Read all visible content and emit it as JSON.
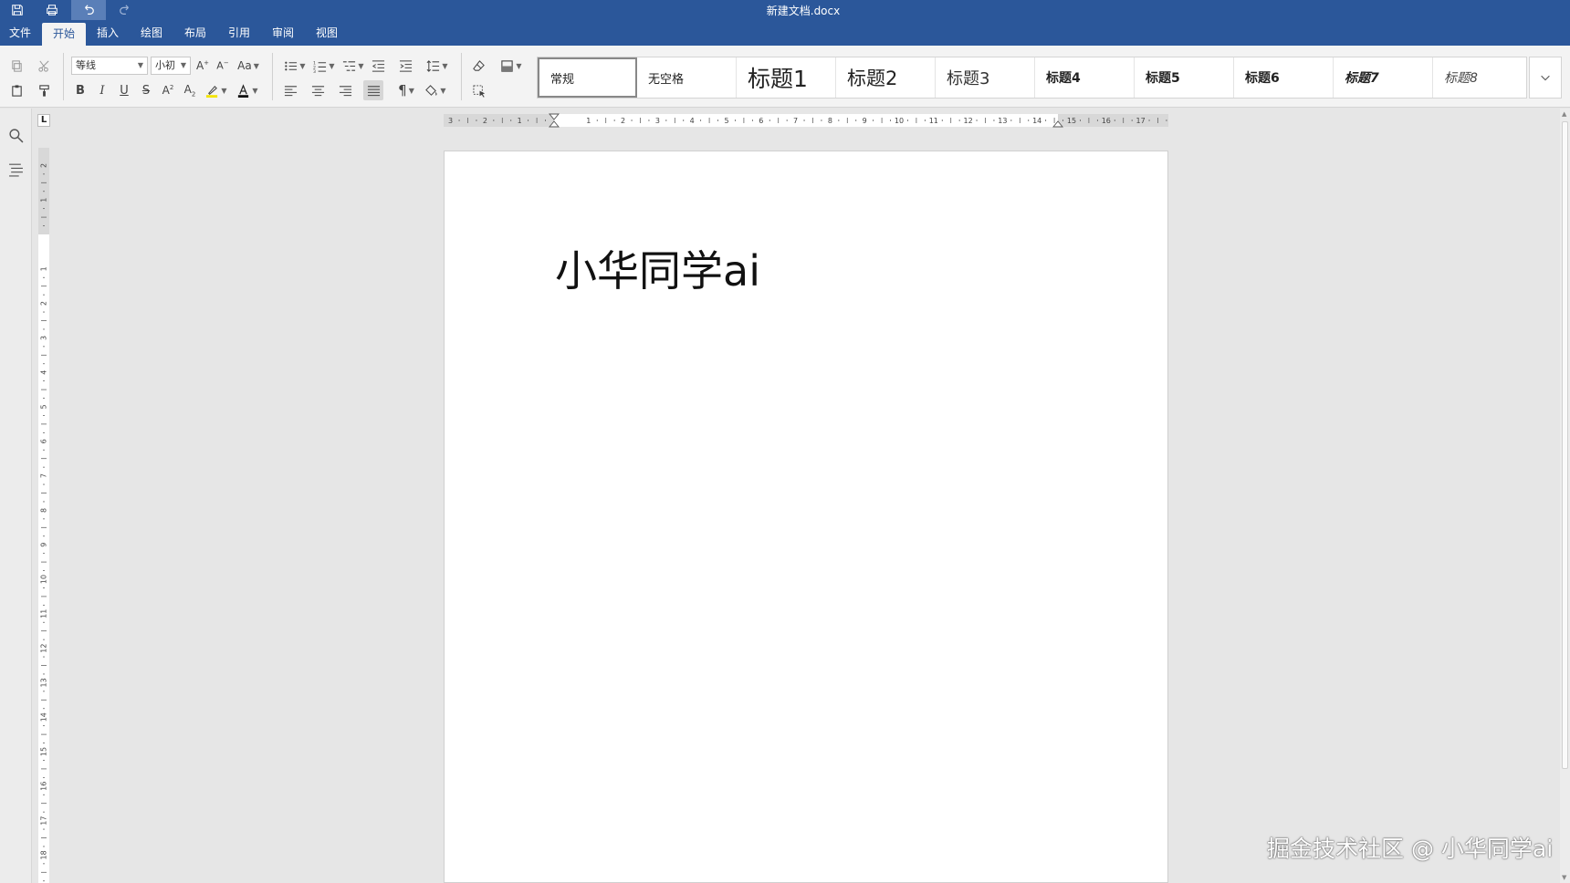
{
  "window": {
    "title": "新建文档.docx"
  },
  "menu": {
    "items": [
      "文件",
      "开始",
      "插入",
      "绘图",
      "布局",
      "引用",
      "审阅",
      "视图"
    ],
    "active": "开始"
  },
  "ribbon": {
    "font_name": "等线",
    "font_size": "小初",
    "styles": [
      "常规",
      "无空格",
      "标题1",
      "标题2",
      "标题3",
      "标题4",
      "标题5",
      "标题6",
      "标题7",
      "标题8"
    ],
    "selected_style": "常规"
  },
  "ruler": {
    "horizontal_labels": [
      "3",
      "2",
      "1",
      "1",
      "2",
      "3",
      "4",
      "5",
      "6",
      "7",
      "8",
      "9",
      "10",
      "11",
      "12",
      "13",
      "14",
      "15",
      "16",
      "17"
    ],
    "vertical_labels": [
      "2",
      "1",
      "1",
      "2",
      "3",
      "4",
      "5",
      "6",
      "7",
      "8",
      "9",
      "10",
      "11",
      "12",
      "13",
      "14",
      "15",
      "16",
      "17",
      "18"
    ],
    "corner_mark": "L"
  },
  "document": {
    "text": "小华同学ai"
  },
  "watermark": "掘金技术社区 @ 小华同学ai",
  "colors": {
    "title_bar": "#2b579a",
    "ribbon": "#f3f3f3",
    "canvas": "#e6e6e6"
  }
}
